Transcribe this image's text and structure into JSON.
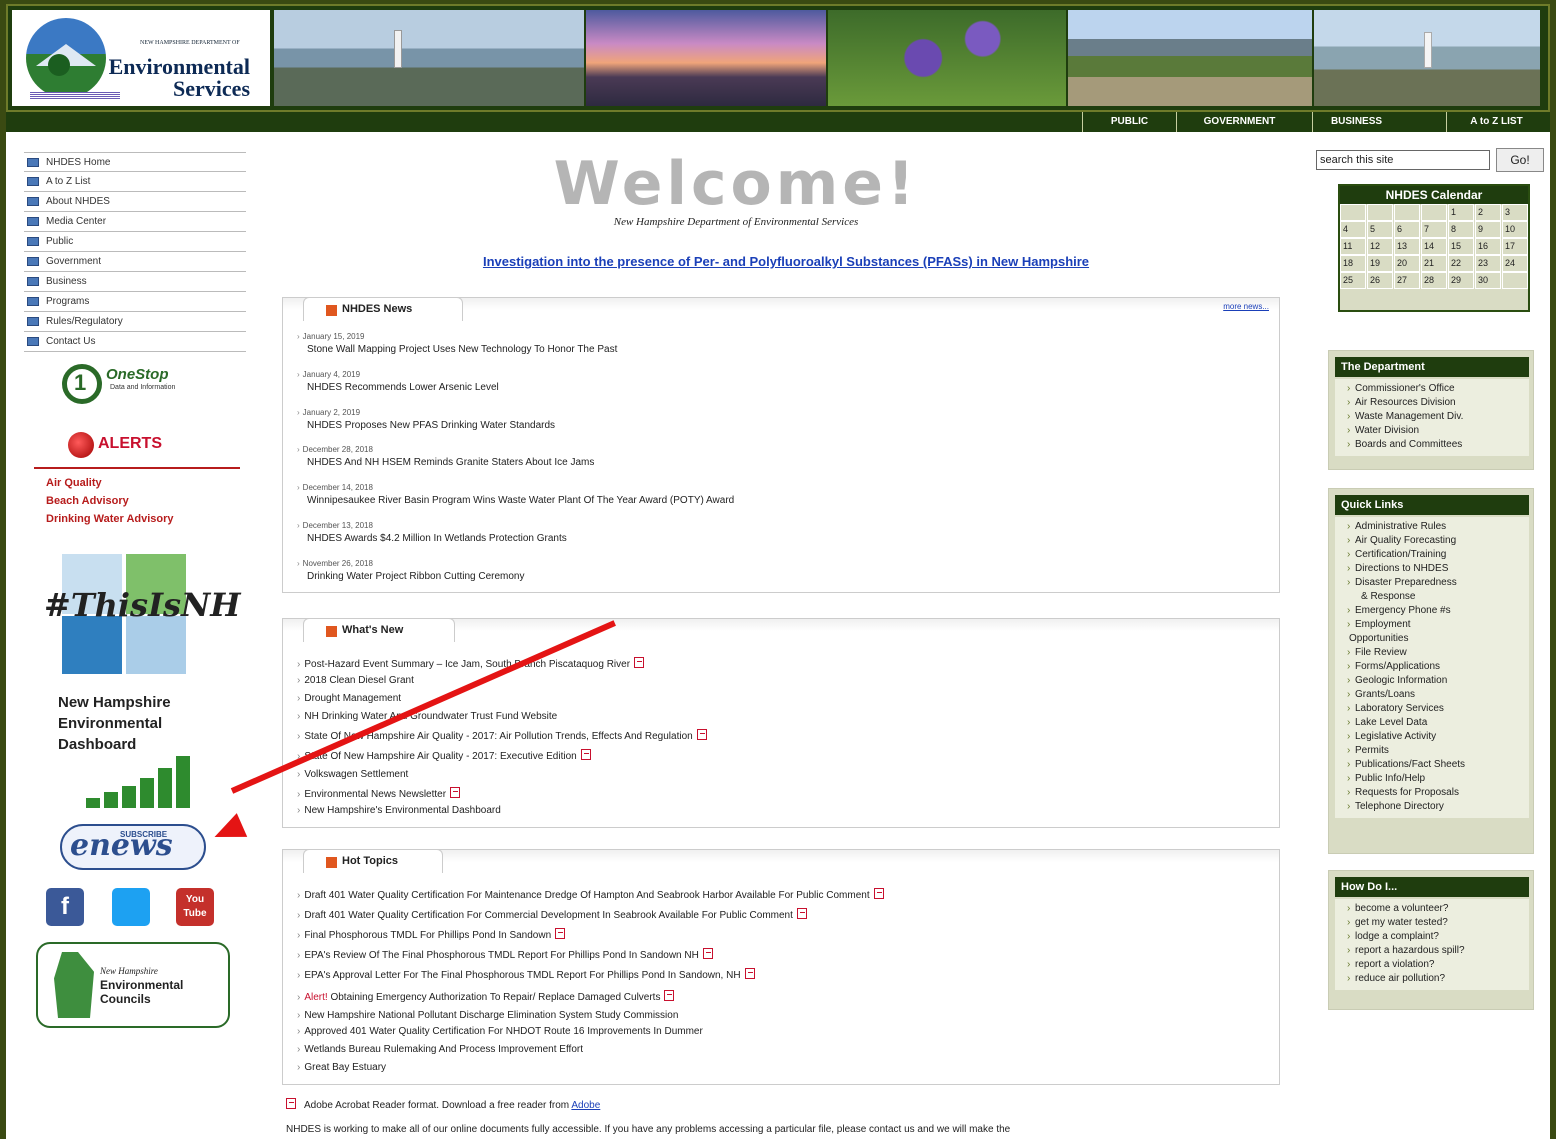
{
  "header": {
    "logo_small": "NEW HAMPSHIRE DEPARTMENT OF",
    "logo_line1": "Environmental",
    "logo_line2": "Services"
  },
  "topnav": [
    "PUBLIC",
    "GOVERNMENT",
    "BUSINESS",
    "A to Z LIST"
  ],
  "leftnav": [
    "NHDES Home",
    "A to Z List",
    "About NHDES",
    "Media Center",
    "Public",
    "Government",
    "Business",
    "Programs",
    "Rules/Regulatory",
    "Contact Us"
  ],
  "onestop": {
    "title": "OneStop",
    "sub": "Data and Information",
    "num": "1"
  },
  "alerts": {
    "title": "ALERTS",
    "links": [
      "Air Quality",
      "Beach Advisory",
      "Drinking Water Advisory"
    ]
  },
  "thisisnh": "#ThisIsNH",
  "dashboard": {
    "lines": [
      "New Hampshire",
      "Environmental",
      "Dashboard"
    ]
  },
  "enews": {
    "sub": "SUBSCRIBE",
    "big": "enews"
  },
  "social": {
    "facebook": "f",
    "twitter": "t",
    "youtube": "You Tube"
  },
  "councils": {
    "line1": "New Hampshire",
    "line2": "Environmental",
    "line3": "Councils"
  },
  "welcome": "Welcome!",
  "dept_subtitle": "New Hampshire Department of Environmental Services",
  "pfas_link": "Investigation into the presence of Per- and Polyfluoroalkyl Substances (PFASs) in New Hampshire",
  "news": {
    "title": "NHDES News",
    "more": "more news...",
    "items": [
      {
        "date": "January 15, 2019",
        "headline": "Stone Wall Mapping Project Uses New Technology To Honor The Past"
      },
      {
        "date": "January 4, 2019",
        "headline": "NHDES Recommends Lower Arsenic Level"
      },
      {
        "date": "January 2, 2019",
        "headline": "NHDES Proposes New PFAS Drinking Water Standards"
      },
      {
        "date": "December 28, 2018",
        "headline": "NHDES And NH HSEM Reminds Granite Staters About Ice Jams"
      },
      {
        "date": "December 14, 2018",
        "headline": "Winnipesaukee River Basin Program Wins Waste Water Plant Of The Year Award (POTY) Award"
      },
      {
        "date": "December 13, 2018",
        "headline": "NHDES Awards $4.2 Million In Wetlands Protection Grants"
      },
      {
        "date": "November 26, 2018",
        "headline": "Drinking Water Project Ribbon Cutting Ceremony"
      }
    ]
  },
  "whatsnew": {
    "title": "What's New",
    "items": [
      {
        "text": "Post-Hazard Event Summary – Ice Jam, South Branch Piscataquog River",
        "pdf": true
      },
      {
        "text": "2018 Clean Diesel Grant",
        "pdf": false
      },
      {
        "text": "Drought Management",
        "pdf": false
      },
      {
        "text": "NH Drinking Water And Groundwater Trust Fund Website",
        "pdf": false
      },
      {
        "text": "State Of New Hampshire Air Quality - 2017: Air Pollution Trends, Effects And Regulation",
        "pdf": true
      },
      {
        "text": "State Of New Hampshire Air Quality - 2017: Executive Edition",
        "pdf": true
      },
      {
        "text": "Volkswagen Settlement",
        "pdf": false
      },
      {
        "text": "Environmental News Newsletter",
        "pdf": true
      },
      {
        "text": "New Hampshire's Environmental Dashboard",
        "pdf": false
      }
    ]
  },
  "hottopics": {
    "title": "Hot Topics",
    "items": [
      {
        "text": "Draft 401 Water Quality Certification For Maintenance Dredge Of Hampton And Seabrook Harbor Available For Public Comment",
        "pdf": true
      },
      {
        "text": "Draft 401 Water Quality Certification For Commercial Development In Seabrook Available For Public Comment",
        "pdf": true
      },
      {
        "text": "Final Phosphorous TMDL For Phillips Pond In Sandown",
        "pdf": true
      },
      {
        "text": "EPA's Review Of The Final Phosphorous TMDL Report For Phillips Pond In Sandown NH",
        "pdf": true
      },
      {
        "text": "EPA's Approval Letter For The Final Phosphorous TMDL Report For Phillips Pond In Sandown, NH",
        "pdf": true
      },
      {
        "alert": "Alert!",
        "text": "Obtaining Emergency Authorization To Repair/ Replace Damaged Culverts",
        "pdf": true
      },
      {
        "text": "New Hampshire National Pollutant Discharge Elimination System Study Commission",
        "pdf": false
      },
      {
        "text": "Approved 401 Water Quality Certification For NHDOT Route 16 Improvements In Dummer",
        "pdf": false
      },
      {
        "text": "Wetlands Bureau Rulemaking And Process Improvement Effort",
        "pdf": false
      },
      {
        "text": "Great Bay Estuary",
        "pdf": false
      }
    ]
  },
  "adobe_note": {
    "text": "Adobe Acrobat Reader format. Download a free reader from",
    "link": "Adobe"
  },
  "access_note": "NHDES is working to make all of our online documents fully accessible. If you have any problems accessing a particular file, please contact us and we will make the",
  "search": {
    "placeholder": "search this site",
    "button": "Go!"
  },
  "calendar": {
    "title": "NHDES Calendar",
    "rows": [
      [
        "",
        "",
        "",
        "",
        "1",
        "2",
        "3"
      ],
      [
        "4",
        "5",
        "6",
        "7",
        "8",
        "9",
        "10"
      ],
      [
        "11",
        "12",
        "13",
        "14",
        "15",
        "16",
        "17"
      ],
      [
        "18",
        "19",
        "20",
        "21",
        "22",
        "23",
        "24"
      ],
      [
        "25",
        "26",
        "27",
        "28",
        "29",
        "30",
        ""
      ]
    ]
  },
  "department": {
    "title": "The Department",
    "items": [
      "Commissioner's Office",
      "Air Resources Division",
      "Waste Management Div.",
      "Water Division",
      "Boards and Committees"
    ]
  },
  "quicklinks": {
    "title": "Quick Links",
    "items": [
      "Administrative Rules",
      "Air Quality Forecasting",
      "Certification/Training",
      "Directions to NHDES",
      "Disaster Preparedness",
      "& Response",
      "Emergency Phone #s",
      "Employment",
      "Opportunities",
      "File Review",
      "Forms/Applications",
      "Geologic Information",
      "Grants/Loans",
      "Laboratory Services",
      "Lake Level Data",
      "Legislative Activity",
      "Permits",
      "Publications/Fact Sheets",
      "Public Info/Help",
      "Requests for Proposals",
      "Telephone Directory"
    ]
  },
  "howdoi": {
    "title": "How Do I...",
    "items": [
      "become a volunteer?",
      "get my water tested?",
      "lodge a complaint?",
      "report a hazardous spill?",
      "report a violation?",
      "reduce air pollution?"
    ]
  },
  "colors": {
    "header_green": "#1f3d0e",
    "panel_bg": "#d9dcc4",
    "alert_red": "#b71c1c",
    "link_blue": "#1a3fb8",
    "annotation_arrow": "#e41414"
  }
}
